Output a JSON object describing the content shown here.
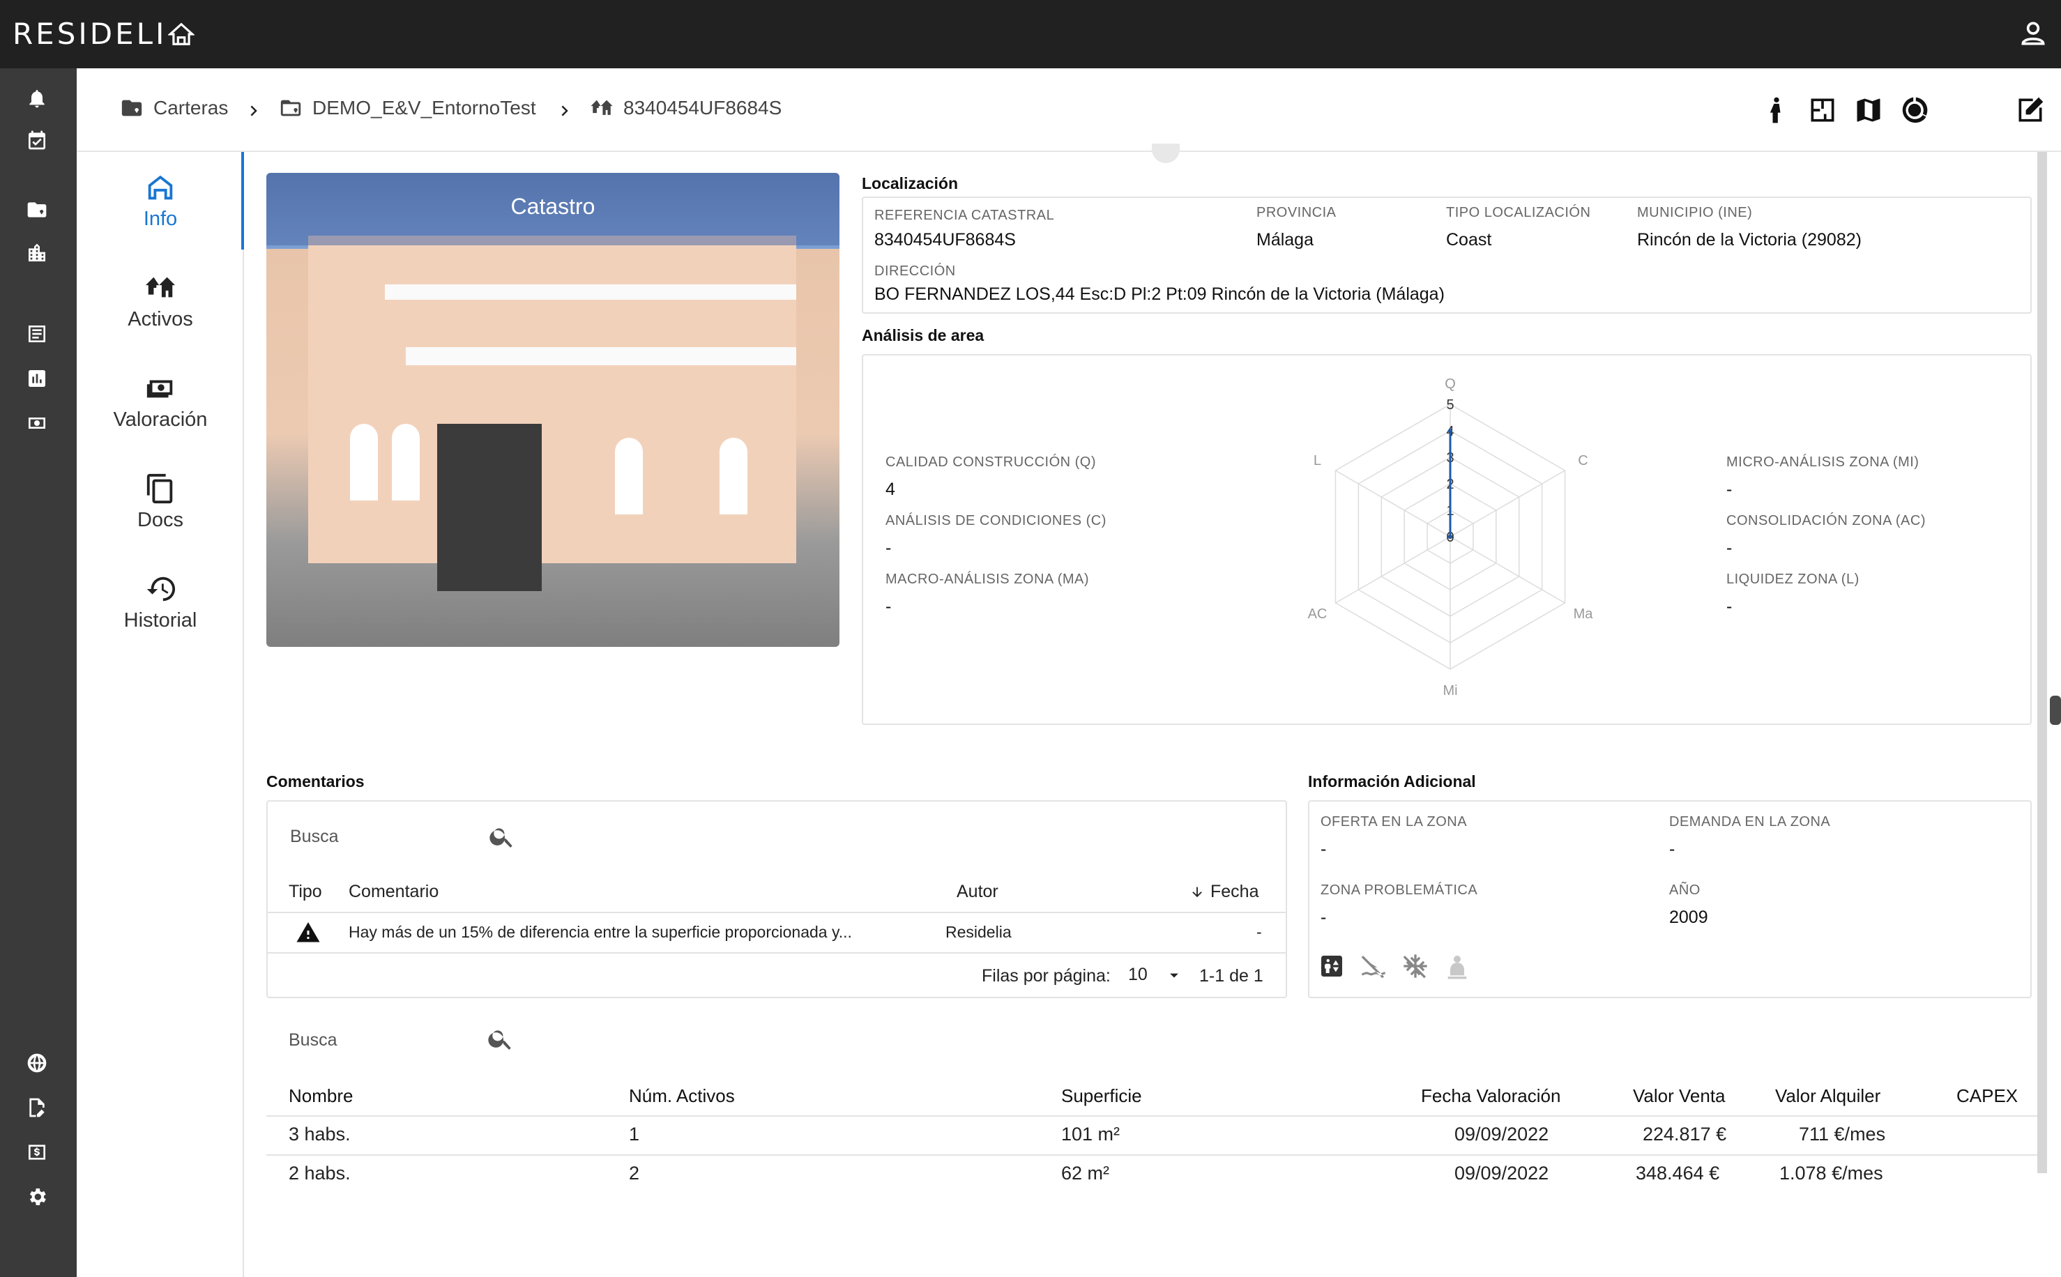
{
  "app": {
    "logo": "RESIDELI"
  },
  "breadcrumb": {
    "items": [
      {
        "label": "Carteras"
      },
      {
        "label": "DEMO_E&V_EntornoTest"
      },
      {
        "label": "8340454UF8684S"
      }
    ]
  },
  "subnav": {
    "items": [
      {
        "label": "Info"
      },
      {
        "label": "Activos"
      },
      {
        "label": "Valoración"
      },
      {
        "label": "Docs"
      },
      {
        "label": "Historial"
      }
    ]
  },
  "photo": {
    "label": "Catastro"
  },
  "localizacion": {
    "title": "Localización",
    "referencia_label": "REFERENCIA CATASTRAL",
    "referencia_value": "8340454UF8684S",
    "provincia_label": "PROVINCIA",
    "provincia_value": "Málaga",
    "tipo_label": "TIPO LOCALIZACIÓN",
    "tipo_value": "Coast",
    "municipio_label": "MUNICIPIO (INE)",
    "municipio_value": "Rincón de la Victoria (29082)",
    "direccion_label": "DIRECCIÓN",
    "direccion_value": "BO FERNANDEZ LOS,44 Esc:D Pl:2 Pt:09 Rincón de la Victoria (Málaga)"
  },
  "analisis": {
    "title": "Análisis de area",
    "left": [
      {
        "label": "CALIDAD CONSTRUCCIÓN (Q)",
        "value": "4"
      },
      {
        "label": "ANÁLISIS DE CONDICIONES (C)",
        "value": "-"
      },
      {
        "label": "MACRO-ANÁLISIS ZONA (MA)",
        "value": "-"
      }
    ],
    "right": [
      {
        "label": "MICRO-ANÁLISIS ZONA (MI)",
        "value": "-"
      },
      {
        "label": "CONSOLIDACIÓN ZONA (AC)",
        "value": "-"
      },
      {
        "label": "LIQUIDEZ ZONA (L)",
        "value": "-"
      }
    ]
  },
  "chart_data": {
    "type": "radar",
    "axes": [
      "Q",
      "C",
      "Ma",
      "Mi",
      "AC",
      "L"
    ],
    "ticks": [
      "0",
      "1",
      "2",
      "3",
      "4",
      "5"
    ],
    "rlim": [
      0,
      5
    ],
    "series": [
      {
        "values": [
          4,
          0,
          0,
          0,
          0,
          0
        ]
      }
    ],
    "grid": true
  },
  "comentarios": {
    "title": "Comentarios",
    "search_placeholder": "Busca",
    "columns": {
      "tipo": "Tipo",
      "comentario": "Comentario",
      "autor": "Autor",
      "fecha": "Fecha"
    },
    "rows": [
      {
        "comentario": "Hay más de un 15% de diferencia entre la superficie proporcionada y...",
        "autor": "Residelia",
        "fecha": "-"
      }
    ],
    "rows_per_page_label": "Filas por página:",
    "rows_per_page": "10",
    "range": "1-1 de 1"
  },
  "info_adicional": {
    "title": "Información Adicional",
    "oferta_label": "OFERTA EN LA ZONA",
    "oferta_value": "-",
    "demanda_label": "DEMANDA EN LA ZONA",
    "demanda_value": "-",
    "zona_label": "ZONA PROBLEMÁTICA",
    "zona_value": "-",
    "anio_label": "AÑO",
    "anio_value": "2009"
  },
  "tipologias": {
    "search_placeholder": "Busca",
    "columns": {
      "nombre": "Nombre",
      "activos": "Núm. Activos",
      "superficie": "Superficie",
      "fecha": "Fecha Valoración",
      "venta": "Valor Venta",
      "alquiler": "Valor Alquiler",
      "capex": "CAPEX"
    },
    "rows": [
      {
        "nombre": "3 habs.",
        "activos": "1",
        "superficie": "101 m²",
        "fecha": "09/09/2022",
        "venta": "224.817 €",
        "alquiler": "711 €/mes",
        "capex": ""
      },
      {
        "nombre": "2 habs.",
        "activos": "2",
        "superficie": "62 m²",
        "fecha": "09/09/2022",
        "venta": "348.464 €",
        "alquiler": "1.078 €/mes",
        "capex": ""
      }
    ]
  },
  "colors": {
    "accent": "#1976d2",
    "topbar": "#212121",
    "rail": "#3a3a3a"
  }
}
